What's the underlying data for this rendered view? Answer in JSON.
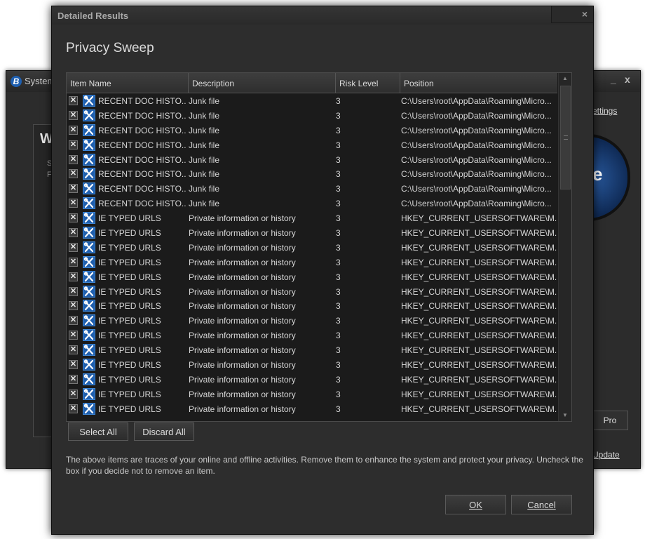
{
  "background_window": {
    "title": "System",
    "letter_w": "W",
    "small_s": "S",
    "small_f": "F",
    "settings_link": "ettings",
    "circle_char": "e",
    "pro_button": "Pro",
    "update_link": "Update",
    "minimize": "_",
    "close": "x"
  },
  "dialog": {
    "title": "Detailed Results",
    "close_glyph": "×",
    "heading": "Privacy Sweep",
    "columns": [
      "Item Name",
      "Description",
      "Risk Level",
      "Position"
    ],
    "rows": [
      {
        "name": "RECENT DOC HISTO...",
        "description": "Junk file",
        "risk": "3",
        "position": "C:\\Users\\root\\AppData\\Roaming\\Micro..."
      },
      {
        "name": "RECENT DOC HISTO...",
        "description": "Junk file",
        "risk": "3",
        "position": "C:\\Users\\root\\AppData\\Roaming\\Micro..."
      },
      {
        "name": "RECENT DOC HISTO...",
        "description": "Junk file",
        "risk": "3",
        "position": "C:\\Users\\root\\AppData\\Roaming\\Micro..."
      },
      {
        "name": "RECENT DOC HISTO...",
        "description": "Junk file",
        "risk": "3",
        "position": "C:\\Users\\root\\AppData\\Roaming\\Micro..."
      },
      {
        "name": "RECENT DOC HISTO...",
        "description": "Junk file",
        "risk": "3",
        "position": "C:\\Users\\root\\AppData\\Roaming\\Micro..."
      },
      {
        "name": "RECENT DOC HISTO...",
        "description": "Junk file",
        "risk": "3",
        "position": "C:\\Users\\root\\AppData\\Roaming\\Micro..."
      },
      {
        "name": "RECENT DOC HISTO...",
        "description": "Junk file",
        "risk": "3",
        "position": "C:\\Users\\root\\AppData\\Roaming\\Micro..."
      },
      {
        "name": "RECENT DOC HISTO...",
        "description": "Junk file",
        "risk": "3",
        "position": "C:\\Users\\root\\AppData\\Roaming\\Micro..."
      },
      {
        "name": "IE TYPED URLS",
        "description": "Private information or history",
        "risk": "3",
        "position": "HKEY_CURRENT_USERSOFTWARE\\M..."
      },
      {
        "name": "IE TYPED URLS",
        "description": "Private information or history",
        "risk": "3",
        "position": "HKEY_CURRENT_USERSOFTWARE\\M..."
      },
      {
        "name": "IE TYPED URLS",
        "description": "Private information or history",
        "risk": "3",
        "position": "HKEY_CURRENT_USERSOFTWARE\\M..."
      },
      {
        "name": "IE TYPED URLS",
        "description": "Private information or history",
        "risk": "3",
        "position": "HKEY_CURRENT_USERSOFTWARE\\M..."
      },
      {
        "name": "IE TYPED URLS",
        "description": "Private information or history",
        "risk": "3",
        "position": "HKEY_CURRENT_USERSOFTWARE\\M..."
      },
      {
        "name": "IE TYPED URLS",
        "description": "Private information or history",
        "risk": "3",
        "position": "HKEY_CURRENT_USERSOFTWARE\\M..."
      },
      {
        "name": "IE TYPED URLS",
        "description": "Private information or history",
        "risk": "3",
        "position": "HKEY_CURRENT_USERSOFTWARE\\M..."
      },
      {
        "name": "IE TYPED URLS",
        "description": "Private information or history",
        "risk": "3",
        "position": "HKEY_CURRENT_USERSOFTWARE\\M..."
      },
      {
        "name": "IE TYPED URLS",
        "description": "Private information or history",
        "risk": "3",
        "position": "HKEY_CURRENT_USERSOFTWARE\\M..."
      },
      {
        "name": "IE TYPED URLS",
        "description": "Private information or history",
        "risk": "3",
        "position": "HKEY_CURRENT_USERSOFTWARE\\M..."
      },
      {
        "name": "IE TYPED URLS",
        "description": "Private information or history",
        "risk": "3",
        "position": "HKEY_CURRENT_USERSOFTWARE\\M..."
      },
      {
        "name": "IE TYPED URLS",
        "description": "Private information or history",
        "risk": "3",
        "position": "HKEY_CURRENT_USERSOFTWARE\\M..."
      },
      {
        "name": "IE TYPED URLS",
        "description": "Private information or history",
        "risk": "3",
        "position": "HKEY_CURRENT_USERSOFTWARE\\M..."
      },
      {
        "name": "IE TYPED URLS",
        "description": "Private information or history",
        "risk": "3",
        "position": "HKEY_CURRENT_USERSOFTWARE\\M..."
      }
    ],
    "checkbox_glyph": "✕",
    "row_icon": "repair-tools-icon",
    "scroll_up": "▲",
    "scroll_down": "▼",
    "select_all": "Select All",
    "discard_all": "Discard All",
    "info_text": "The above items are traces of your online and offline activities. Remove them to enhance the system and protect your privacy. Uncheck the box if you decide not to remove an item.",
    "ok": "OK",
    "cancel": "Cancel"
  },
  "colors": {
    "background": "#2d2d2d",
    "grid": "#1b1b1b",
    "icon_blue": "#1f5fae",
    "text": "#d6d6d6"
  }
}
